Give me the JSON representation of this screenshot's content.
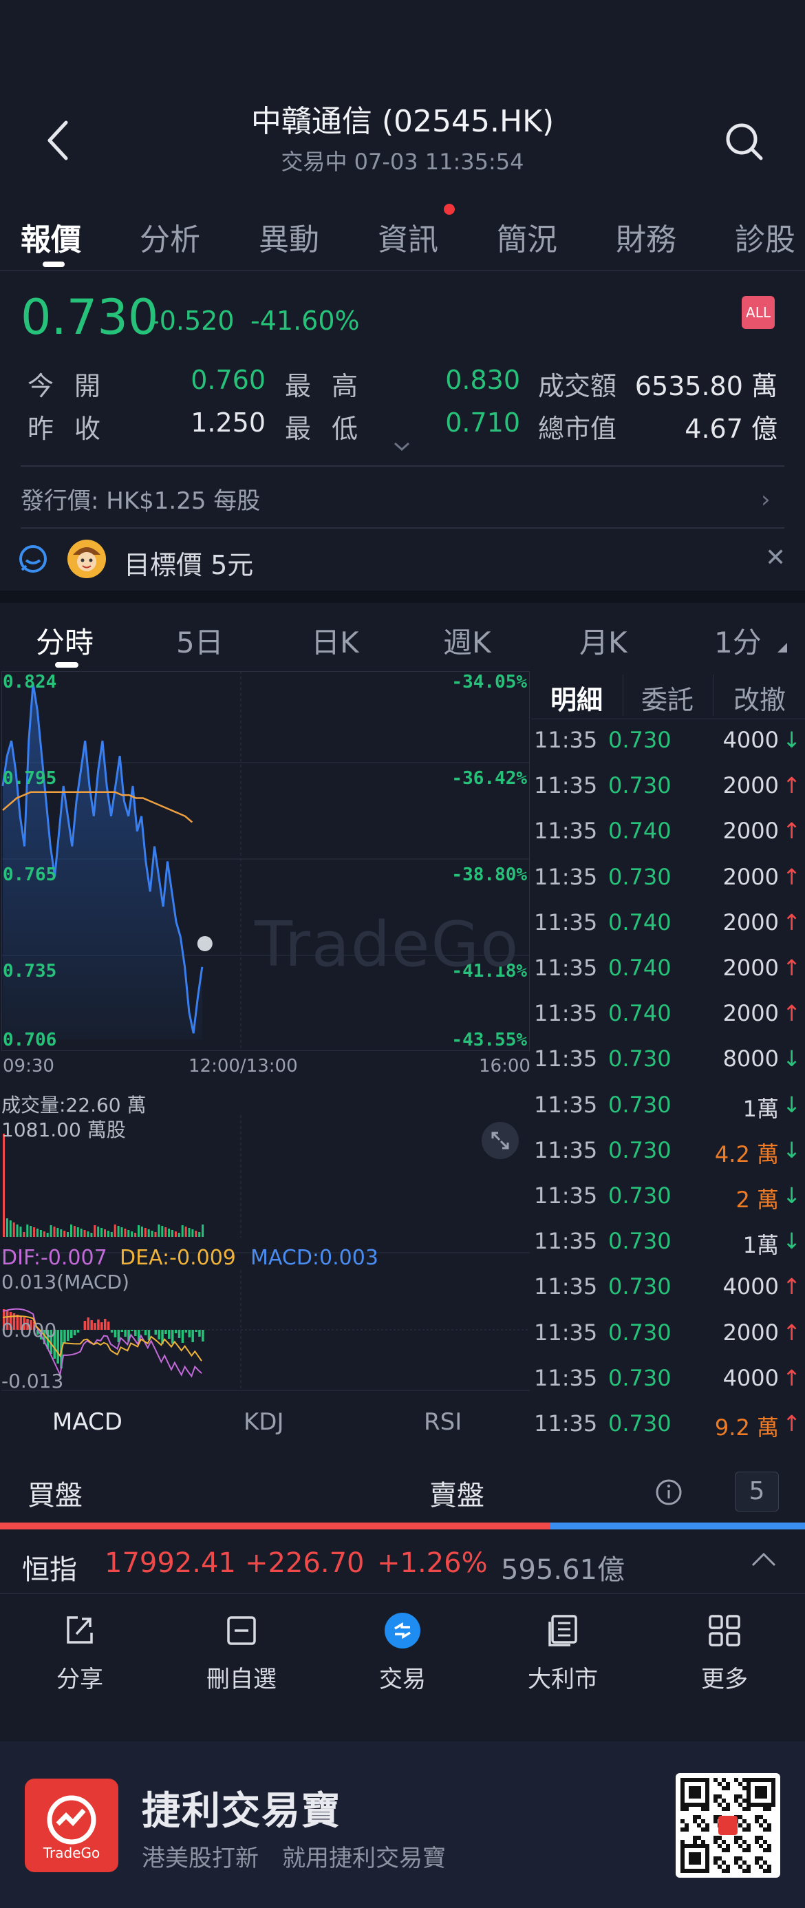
{
  "header": {
    "title": "中贛通信 (02545.HK)",
    "subtitle": "交易中 07-03 11:35:54"
  },
  "tabs": [
    "報價",
    "分析",
    "異動",
    "資訊",
    "簡況",
    "財務",
    "診股"
  ],
  "quote": {
    "price": "0.730",
    "change": "-0.520",
    "change_pct": "-41.60%",
    "badge": "ALL",
    "open_label": "今開",
    "open": "0.760",
    "high_label": "最高",
    "high": "0.830",
    "turnover_label": "成交額",
    "turnover": "6535.80 萬",
    "prev_close_label": "昨收",
    "prev_close": "1.250",
    "low_label": "最低",
    "low": "0.710",
    "mkt_cap_label": "總市值",
    "mkt_cap": "4.67 億",
    "ipo_text": "發行價: HK$1.25 每股",
    "target_text": "目標價 5元"
  },
  "chart_tabs": [
    "分時",
    "5日",
    "日K",
    "週K",
    "月K",
    "1分"
  ],
  "chart": {
    "y_left": [
      "0.824",
      "0.795",
      "0.765",
      "0.735",
      "0.706"
    ],
    "y_right": [
      "-34.05%",
      "-36.42%",
      "-38.80%",
      "-41.18%",
      "-43.55%"
    ],
    "x_labels": [
      "09:30",
      "12:00/13:00",
      "16:00"
    ],
    "watermark": "TradeGo",
    "volume_label": "成交量:22.60 萬",
    "volume_max": "1081.00 萬股",
    "macd_dif": "DIF:-0.007",
    "macd_dea": "DEA:-0.009",
    "macd_macd": "MACD:0.003",
    "macd_top": "0.013(MACD)",
    "macd_zero": "0.000",
    "macd_bottom": "-0.013",
    "indicators": [
      "MACD",
      "KDJ",
      "RSI"
    ],
    "colors": {
      "price_line": "#3a7ff0",
      "avg_line": "#f0a040",
      "up": "#f0494a",
      "down": "#27c27a"
    }
  },
  "chart_data": {
    "type": "line",
    "title": "",
    "xlabel": "",
    "ylabel": "",
    "ylim": [
      0.706,
      0.824
    ],
    "series": [
      {
        "values": [
          0.79,
          0.8,
          0.805,
          0.795,
          0.78,
          0.77,
          0.805,
          0.824,
          0.815,
          0.8,
          0.785,
          0.77,
          0.76,
          0.775,
          0.79,
          0.78,
          0.77,
          0.785,
          0.795,
          0.805,
          0.79,
          0.78,
          0.795,
          0.805,
          0.79,
          0.78,
          0.79,
          0.8,
          0.785,
          0.78,
          0.79,
          0.775,
          0.78,
          0.765,
          0.755,
          0.77,
          0.76,
          0.75,
          0.765,
          0.755,
          0.745,
          0.74,
          0.73,
          0.715,
          0.708,
          0.72,
          0.73
        ]
      },
      {
        "values": [
          0.782,
          0.784,
          0.786,
          0.787,
          0.788,
          0.788,
          0.788,
          0.788,
          0.788,
          0.788,
          0.788,
          0.788,
          0.788,
          0.788,
          0.788,
          0.788,
          0.788,
          0.787,
          0.787,
          0.786,
          0.786,
          0.785,
          0.784,
          0.783,
          0.782,
          0.781,
          0.78,
          0.778
        ]
      }
    ]
  },
  "detail": {
    "tabs": [
      "明細",
      "委託",
      "改撤"
    ],
    "rows": [
      {
        "time": "11:35",
        "price": "0.730",
        "vol": "4000",
        "dir": "down"
      },
      {
        "time": "11:35",
        "price": "0.730",
        "vol": "2000",
        "dir": "up"
      },
      {
        "time": "11:35",
        "price": "0.740",
        "vol": "2000",
        "dir": "up"
      },
      {
        "time": "11:35",
        "price": "0.730",
        "vol": "2000",
        "dir": "up"
      },
      {
        "time": "11:35",
        "price": "0.740",
        "vol": "2000",
        "dir": "up"
      },
      {
        "time": "11:35",
        "price": "0.740",
        "vol": "2000",
        "dir": "up"
      },
      {
        "time": "11:35",
        "price": "0.740",
        "vol": "2000",
        "dir": "up"
      },
      {
        "time": "11:35",
        "price": "0.730",
        "vol": "8000",
        "dir": "down"
      },
      {
        "time": "11:35",
        "price": "0.730",
        "vol": "1萬",
        "dir": "down"
      },
      {
        "time": "11:35",
        "price": "0.730",
        "vol": "4.2 萬",
        "dir": "down",
        "big": true
      },
      {
        "time": "11:35",
        "price": "0.730",
        "vol": "2 萬",
        "dir": "down",
        "big": true
      },
      {
        "time": "11:35",
        "price": "0.730",
        "vol": "1萬",
        "dir": "down"
      },
      {
        "time": "11:35",
        "price": "0.730",
        "vol": "4000",
        "dir": "up"
      },
      {
        "time": "11:35",
        "price": "0.730",
        "vol": "2000",
        "dir": "up"
      },
      {
        "time": "11:35",
        "price": "0.730",
        "vol": "4000",
        "dir": "up"
      },
      {
        "time": "11:35",
        "price": "0.730",
        "vol": "9.2 萬",
        "dir": "up",
        "big": true
      }
    ]
  },
  "orderbook": {
    "buy_label": "買盤",
    "sell_label": "賣盤",
    "depth": "5",
    "buy_ratio": 0.684
  },
  "index": {
    "name": "恒指",
    "price": "17992.41",
    "change": "+226.70",
    "change_pct": "+1.26%",
    "turnover": "595.61億"
  },
  "nav": [
    "分享",
    "刪自選",
    "交易",
    "大利市",
    "更多"
  ],
  "ad": {
    "logo_text": "TradeGo",
    "title": "捷利交易寶",
    "subtitle": "港美股打新　就用捷利交易寶"
  }
}
